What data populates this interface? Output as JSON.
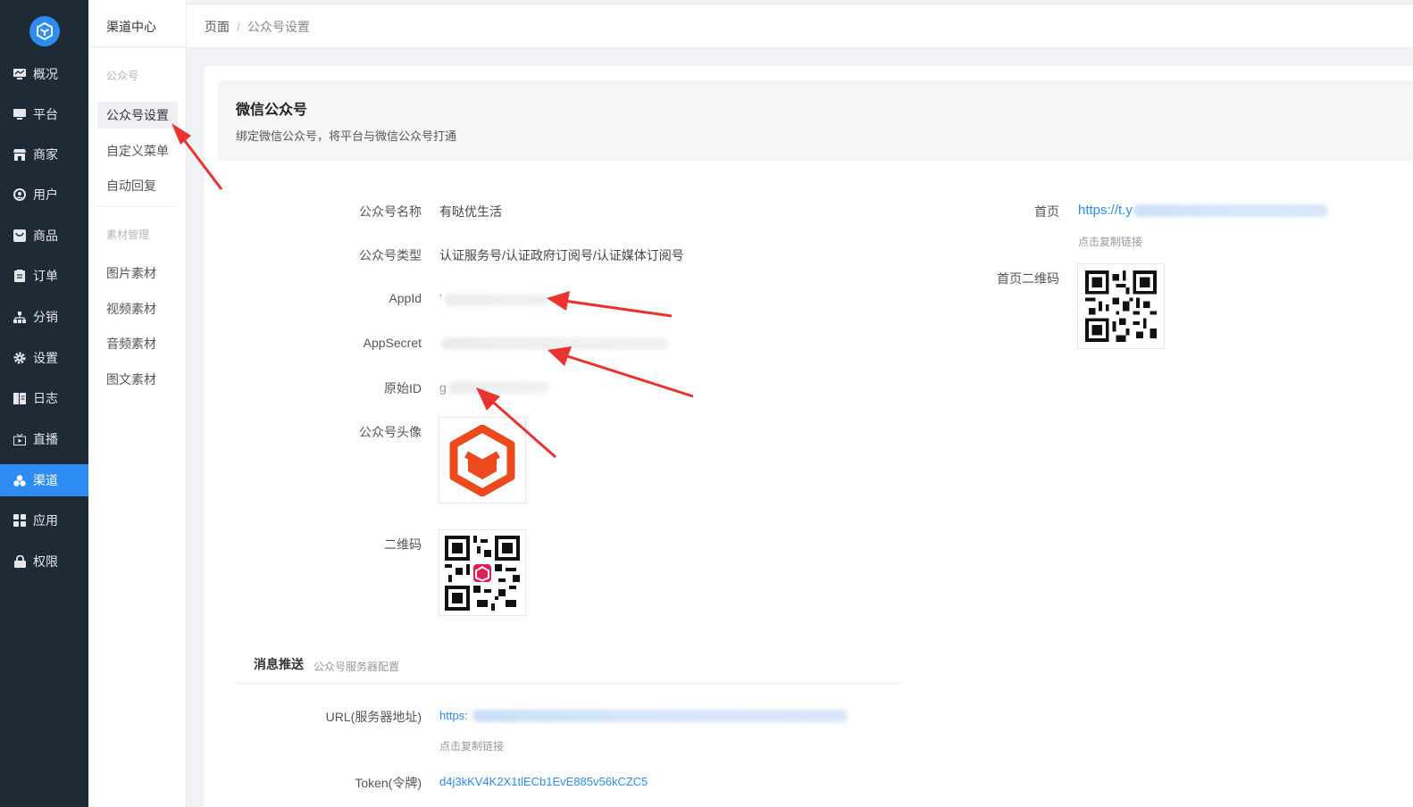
{
  "sidebar": {
    "items": [
      {
        "label": "概况",
        "icon": "dashboard-icon"
      },
      {
        "label": "平台",
        "icon": "monitor-icon"
      },
      {
        "label": "商家",
        "icon": "store-icon"
      },
      {
        "label": "用户",
        "icon": "user-icon"
      },
      {
        "label": "商品",
        "icon": "goods-icon"
      },
      {
        "label": "订单",
        "icon": "order-icon"
      },
      {
        "label": "分销",
        "icon": "distribution-icon"
      },
      {
        "label": "设置",
        "icon": "gear-icon"
      },
      {
        "label": "日志",
        "icon": "log-icon"
      },
      {
        "label": "直播",
        "icon": "live-icon"
      },
      {
        "label": "渠道",
        "icon": "channel-icon",
        "active": true
      },
      {
        "label": "应用",
        "icon": "apps-icon"
      },
      {
        "label": "权限",
        "icon": "lock-icon"
      }
    ]
  },
  "subnav": {
    "title": "渠道中心",
    "group1": "公众号",
    "items1": [
      "公众号设置",
      "自定义菜单",
      "自动回复"
    ],
    "group2": "素材管理",
    "items2": [
      "图片素材",
      "视频素材",
      "音频素材",
      "图文素材"
    ]
  },
  "breadcrumb": {
    "first": "页面",
    "sep": "/",
    "current": "公众号设置"
  },
  "banner": {
    "title": "微信公众号",
    "desc": "绑定微信公众号，将平台与微信公众号打通"
  },
  "form": {
    "name_label": "公众号名称",
    "name_value": "有哒优生活",
    "type_label": "公众号类型",
    "type_value": "认证服务号/认证政府订阅号/认证媒体订阅号",
    "appid_label": "AppId",
    "appid_value": "'",
    "appsecret_label": "AppSecret",
    "origid_label": "原始ID",
    "origid_value": "g",
    "avatar_label": "公众号头像",
    "qrcode_label": "二维码",
    "home_label": "首页",
    "home_value": "https://t.y",
    "home_hint": "点击复制链接",
    "home_qr_label": "首页二维码"
  },
  "push": {
    "title": "消息推送",
    "subtitle": "公众号服务器配置",
    "url_label": "URL(服务器地址)",
    "url_value": "https:",
    "url_hint": "点击复制链接",
    "token_label": "Token(令牌)",
    "token_value": "d4j3kKV4K2X1tlECb1EvE885v56kCZC5"
  },
  "colors": {
    "accent": "#2d8cf0",
    "sidebar_bg": "#1f2a37",
    "arrow": "#e8332f",
    "brand_logo": "#ec4a1c"
  }
}
